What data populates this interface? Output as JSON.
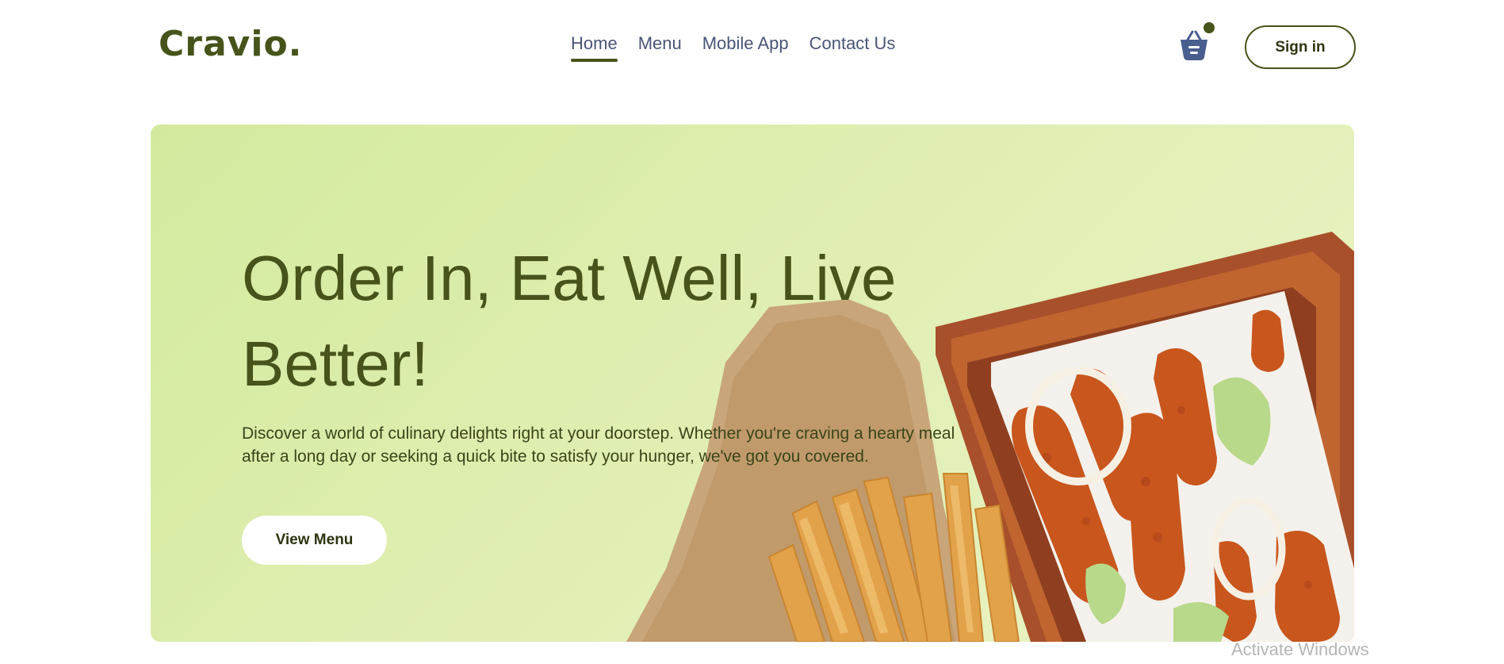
{
  "header": {
    "logo": "Cravio.",
    "nav": [
      {
        "label": "Home",
        "active": true
      },
      {
        "label": "Menu",
        "active": false
      },
      {
        "label": "Mobile App",
        "active": false
      },
      {
        "label": "Contact Us",
        "active": false
      }
    ],
    "cart_icon": "basket-icon",
    "signin_label": "Sign in"
  },
  "hero": {
    "title": "Order In, Eat Well, Live Better!",
    "description": "Discover a world of culinary delights right at your doorstep. Whether you're craving a hearty meal after a long day or seeking a quick bite to satisfy your hunger, we've got you covered.",
    "button_label": "View Menu",
    "image": "fried-chicken-and-fries-on-wooden-tray"
  },
  "os": {
    "watermark": "Activate Windows"
  },
  "colors": {
    "brand": "#46531a",
    "nav_text": "#4a5577",
    "hero_bg": "#dfeeb1"
  }
}
